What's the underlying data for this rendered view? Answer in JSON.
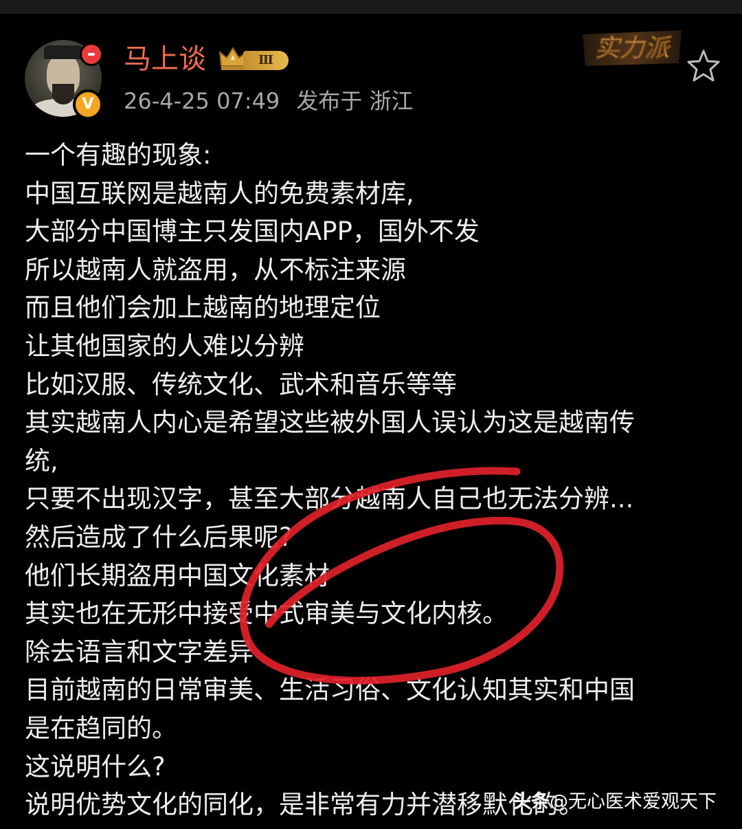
{
  "post": {
    "author": {
      "name": "马上谈",
      "level": "Ⅲ"
    },
    "meta": {
      "datetime": "26-4-25 07:49",
      "location": "发布于 浙江"
    },
    "corner_badge_text": "实力派",
    "lines": [
      "一个有趣的现象:",
      "中国互联网是越南人的免费素材库,",
      "大部分中国博主只发国内APP，国外不发",
      "所以越南人就盗用，从不标注来源",
      "而且他们会加上越南的地理定位",
      "让其他国家的人难以分辨",
      "比如汉服、传统文化、武术和音乐等等",
      "其实越南人内心是希望这些被外国人误认为这是越南传",
      "统,",
      "只要不出现汉字，甚至大部分越南人自己也无法分辨...",
      "然后造成了什么后果呢?",
      "他们长期盗用中国文化素材",
      "其实也在无形中接受中式审美与文化内核。",
      "除去语言和文字差异",
      "目前越南的日常审美、生活习俗、文化认知其实和中国",
      "是在趋同的。",
      "这说明什么?",
      "说明优势文化的同化，是非常有力并潜移默化的。"
    ]
  },
  "watermark": {
    "logo": "头条",
    "handle": "@无心医术爱观天下"
  },
  "colors": {
    "background": "#000000",
    "text": "#eeeeee",
    "username": "#f26a4f",
    "meta": "#a8a8a8",
    "annotation": "#e0222a",
    "verified": "#f5a623"
  },
  "icons": {
    "verified": "verified-v-icon",
    "star": "star-outline-icon",
    "crown": "crown-icon"
  }
}
